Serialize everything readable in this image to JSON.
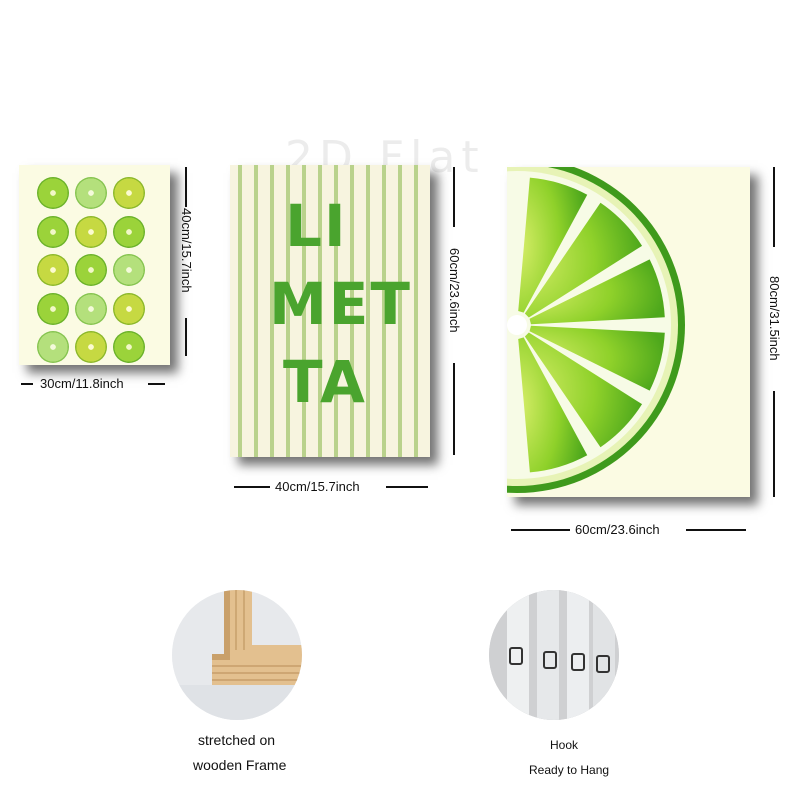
{
  "watermark": "2D Flat",
  "panels": [
    {
      "name": "lime-grid-print",
      "width_label": "30cm/11.8inch",
      "height_label": "40cm/15.7inch"
    },
    {
      "name": "limetta-text-print",
      "text_lines": [
        "LI",
        "MET",
        "TA"
      ],
      "width_label": "40cm/15.7inch",
      "height_label": "60cm/23.6inch"
    },
    {
      "name": "lime-slice-print",
      "width_label": "60cm/23.6inch",
      "height_label": "80cm/31.5inch"
    }
  ],
  "features": [
    {
      "name": "wooden-frame",
      "caption_lines": [
        "stretched on",
        "wooden Frame"
      ]
    },
    {
      "name": "hook",
      "caption_lines": [
        "Hook",
        "Ready to Hang"
      ]
    }
  ],
  "colors": {
    "lime_green": "#4aa42e",
    "stripe": "#b9d28c",
    "cream": "#fbfbe3"
  }
}
